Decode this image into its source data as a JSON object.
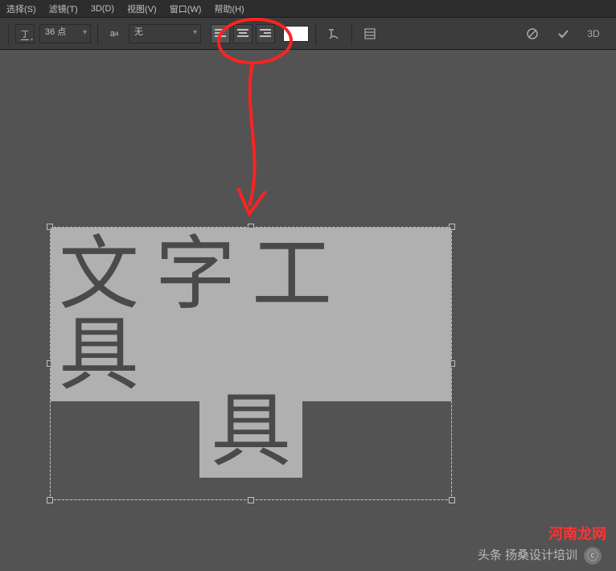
{
  "menu": [
    "选择(S)",
    "滤镜(T)",
    "3D(D)",
    "视图(V)",
    "窗口(W)",
    "帮助(H)"
  ],
  "options": {
    "font_size": "36 点",
    "antialias": "无",
    "color_swatch": "#ffffff",
    "three_d_label": "3D"
  },
  "canvas_text": {
    "line1": "文字工具",
    "line2": "具"
  },
  "watermarks": {
    "wm1": "河南龙网",
    "wm2": "头条 扬桑设计培训",
    "wm_icon": "ⓒ"
  }
}
